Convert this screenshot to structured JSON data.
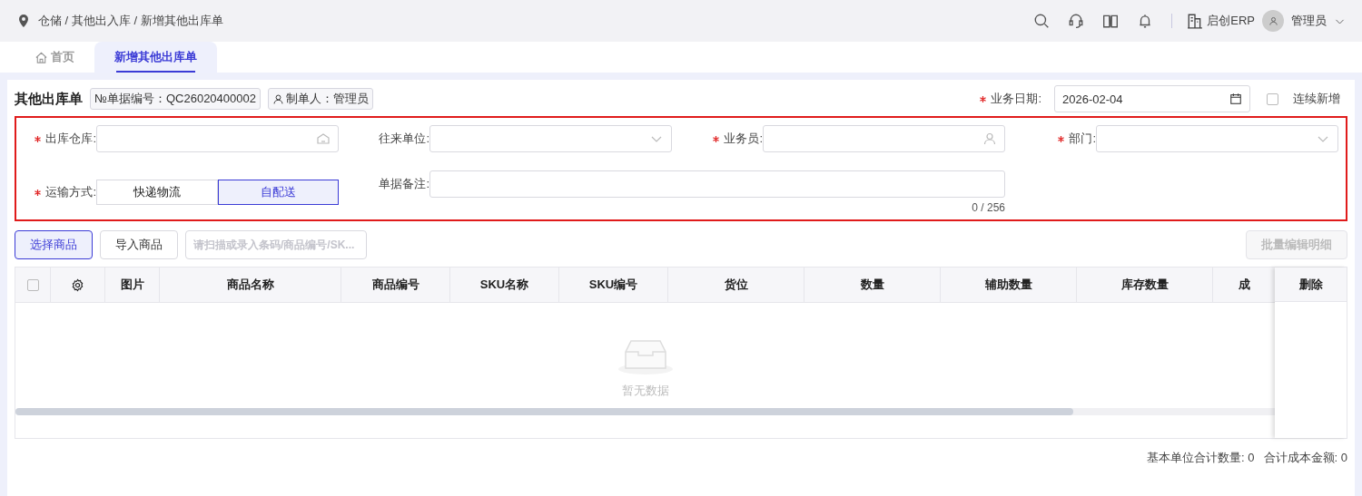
{
  "breadcrumb": "仓储 / 其他出入库 / 新增其他出库单",
  "header": {
    "company": "启创ERP",
    "user": "管理员"
  },
  "tabs": [
    {
      "label": "首页",
      "selected": false,
      "kind": "home"
    },
    {
      "label": "新增其他出库单",
      "selected": true,
      "kind": "page"
    }
  ],
  "form": {
    "title": "其他出库单",
    "doc_no_label": "№单据编号：",
    "doc_no": "QC26020400002",
    "creator_label": "制单人：",
    "creator": "管理员",
    "date": {
      "label": "业务日期:",
      "required": true,
      "value": "2026-02-04"
    },
    "continuous": {
      "label": "连续新增",
      "checked": false
    },
    "fields": [
      {
        "label": "出库仓库:",
        "required": true,
        "kind": "warehouse"
      },
      {
        "label": "往来单位:",
        "required": false,
        "kind": "select"
      },
      {
        "label": "业务员:",
        "required": true,
        "kind": "person"
      },
      {
        "label": "部门:",
        "required": true,
        "kind": "select"
      }
    ],
    "shipping": {
      "label": "运输方式:",
      "required": true,
      "options": [
        {
          "label": "快递物流",
          "selected": false
        },
        {
          "label": "自配送",
          "selected": true
        }
      ]
    },
    "remark": {
      "label": "单据备注:",
      "required": false,
      "counter": "0 / 256"
    }
  },
  "toolbar": {
    "select_button": "选择商品",
    "import_button": "导入商品",
    "scan_placeholder": "请扫描或录入条码/商品编号/SK...",
    "batch_button": "批量编辑明细"
  },
  "table": {
    "columns": [
      "图片",
      "商品名称",
      "商品编号",
      "SKU名称",
      "SKU编号",
      "货位",
      "数量",
      "辅助数量",
      "库存数量",
      "成"
    ],
    "fixed_column": "删除",
    "select_all_checked": false,
    "empty_text": "暂无数据"
  },
  "footer": {
    "total_qty_label": "基本单位合计数量:",
    "total_qty": "0",
    "total_cost_label": "合计成本金额:",
    "total_cost": "0"
  }
}
